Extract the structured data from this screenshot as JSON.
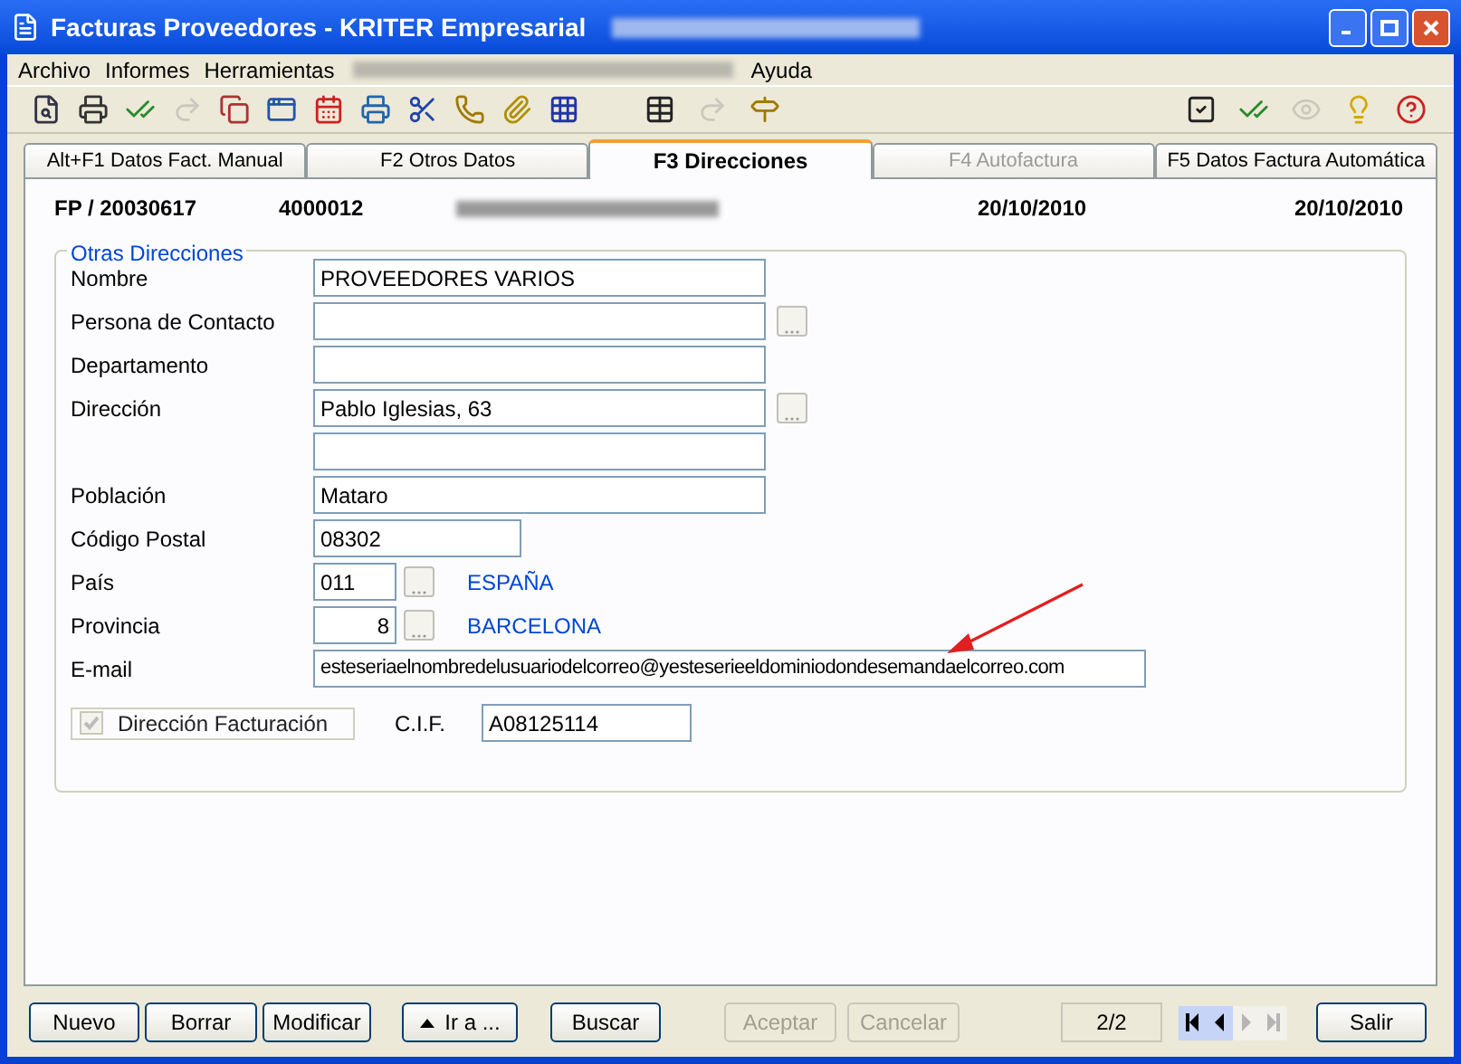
{
  "window": {
    "title": "Facturas Proveedores  - KRITER Empresarial"
  },
  "menu": [
    {
      "label": "Archivo"
    },
    {
      "label": "Informes"
    },
    {
      "label": "Herramientas"
    },
    {
      "label": "Ayuda"
    }
  ],
  "toolbar_left": [
    {
      "kind": "preview",
      "disabled": false
    },
    {
      "kind": "print",
      "disabled": false
    },
    {
      "kind": "check",
      "disabled": false
    },
    {
      "kind": "forward",
      "disabled": true
    },
    {
      "kind": "copy",
      "disabled": false
    },
    {
      "kind": "window",
      "disabled": false
    },
    {
      "kind": "calendar",
      "disabled": false
    },
    {
      "kind": "printer",
      "disabled": false
    },
    {
      "kind": "cut",
      "disabled": false
    },
    {
      "kind": "phone",
      "disabled": false
    },
    {
      "kind": "clip",
      "disabled": false
    },
    {
      "kind": "grid",
      "disabled": false
    }
  ],
  "toolbar_middle": [
    {
      "kind": "table",
      "disabled": false
    },
    {
      "kind": "forward",
      "disabled": true
    },
    {
      "kind": "signpost",
      "disabled": false
    }
  ],
  "toolbar_right": [
    {
      "kind": "checkbox",
      "disabled": false
    },
    {
      "kind": "check",
      "disabled": false
    },
    {
      "kind": "eye",
      "disabled": true
    },
    {
      "kind": "bulb",
      "disabled": false
    },
    {
      "kind": "help",
      "disabled": false
    }
  ],
  "tabs": [
    {
      "label": "Alt+F1 Datos Fact. Manual",
      "selected": false,
      "disabled": false
    },
    {
      "label": "F2 Otros Datos",
      "selected": false,
      "disabled": false
    },
    {
      "label": "F3 Direcciones",
      "selected": true,
      "disabled": false
    },
    {
      "label": "F4 Autofactura",
      "selected": false,
      "disabled": true
    },
    {
      "label": "F5 Datos Factura Automática",
      "selected": false,
      "disabled": false
    }
  ],
  "header": {
    "invoice": "FP / 20030617",
    "code": "4000012",
    "date_1": "20/10/2010",
    "date_2": "20/10/2010"
  },
  "group": {
    "title": "Otras Direcciones",
    "rows": [
      {
        "label": "Nombre",
        "value": "PROVEEDORES VARIOS",
        "kind": "wide",
        "lookup": false
      },
      {
        "label": "Persona de Contacto",
        "value": "",
        "kind": "wide",
        "lookup": true
      },
      {
        "label": "Departamento",
        "value": "",
        "kind": "wide",
        "lookup": false
      },
      {
        "label": "Dirección",
        "value": "Pablo Iglesias, 63",
        "kind": "wide",
        "lookup": true
      },
      {
        "label": "",
        "value": "",
        "kind": "wide",
        "lookup": false
      },
      {
        "label": "Población",
        "value": "Mataro",
        "kind": "wide",
        "lookup": false
      },
      {
        "label": "Código Postal",
        "value": "08302",
        "kind": "medium",
        "lookup": false
      },
      {
        "label": "País",
        "value": "011",
        "kind": "code",
        "lookup": true,
        "name": "ESPAÑA"
      },
      {
        "label": "Provincia",
        "value": "8",
        "kind": "code_right",
        "lookup": true,
        "name": "BARCELONA"
      },
      {
        "label": "E-mail",
        "value": "esteseriaelnombredelusuariodelcorreo@yesteserieeldominiodondesemandaelcorreo.com",
        "kind": "email",
        "lookup": false
      }
    ],
    "billing": {
      "label": "Dirección Facturación",
      "checked": true,
      "disabled": true
    },
    "cif": {
      "label": "C.I.F.",
      "value": "A08125114"
    }
  },
  "buttons": [
    {
      "label": "Nuevo",
      "disabled": false,
      "kind": "plain"
    },
    {
      "label": "Borrar",
      "disabled": false,
      "kind": "plain"
    },
    {
      "label": "Modificar",
      "disabled": false,
      "kind": "plain"
    },
    {
      "label": "Ir a ...",
      "disabled": false,
      "kind": "goto"
    },
    {
      "label": "Buscar",
      "disabled": false,
      "kind": "plain"
    },
    {
      "label": "Aceptar",
      "disabled": true,
      "kind": "plain"
    },
    {
      "label": "Cancelar",
      "disabled": true,
      "kind": "plain"
    }
  ],
  "record": "2/2",
  "nav": [
    {
      "kind": "first",
      "disabled": false
    },
    {
      "kind": "prev",
      "disabled": false
    },
    {
      "kind": "next",
      "disabled": true
    },
    {
      "kind": "last",
      "disabled": true
    }
  ],
  "exit": {
    "label": "Salir",
    "disabled": false
  }
}
